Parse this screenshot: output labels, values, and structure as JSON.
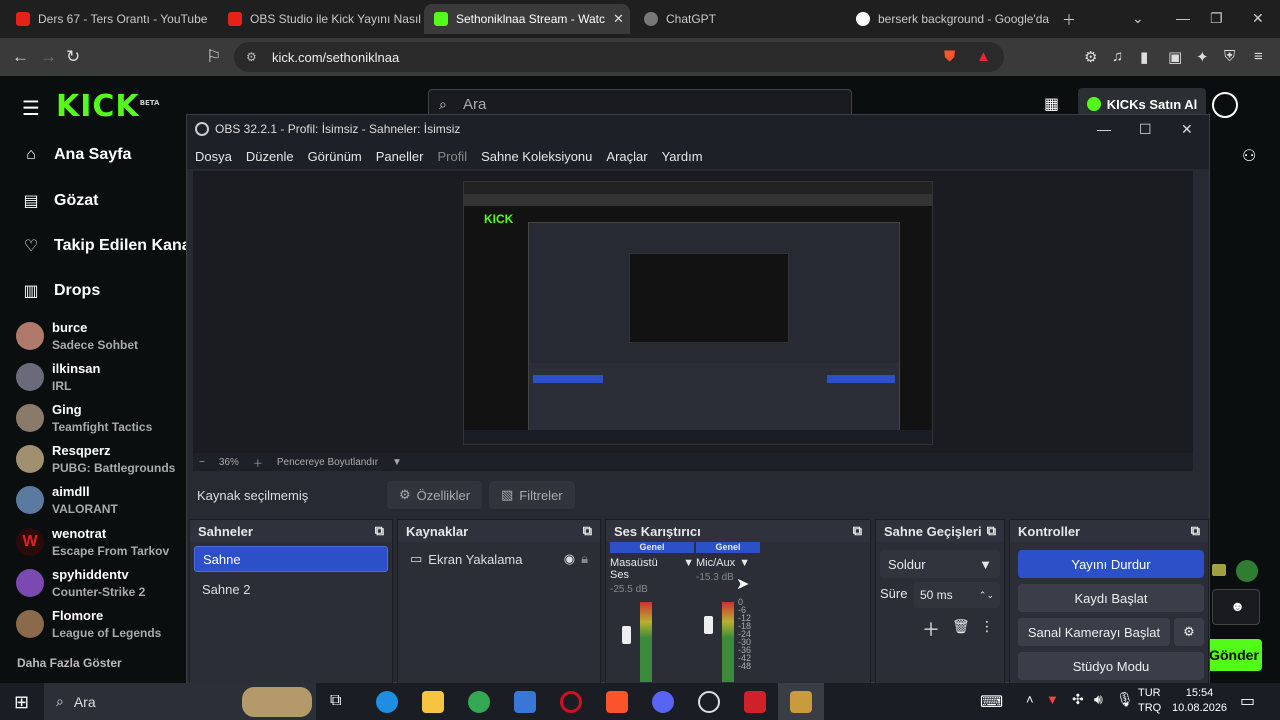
{
  "browser": {
    "tabs": [
      {
        "title": "Ders 67 - Ters Orantı - YouTube",
        "active": false
      },
      {
        "title": "OBS Studio ile Kick Yayını Nasıl A",
        "active": false
      },
      {
        "title": "Sethoniklnaa Stream - Watc",
        "active": true
      },
      {
        "title": "ChatGPT",
        "active": false
      },
      {
        "title": "berserk background - Google'da",
        "active": false
      }
    ],
    "url": "kick.com/sethoniklnaa"
  },
  "kick": {
    "logo": "KICK",
    "logo_badge": "BETA",
    "search_placeholder": "Ara",
    "kicks_button": "KICKs Satın Al",
    "nav": [
      {
        "label": "Ana Sayfa",
        "icon": "home-icon"
      },
      {
        "label": "Gözat",
        "icon": "browse-icon"
      },
      {
        "label": "Takip Edilen Kanal",
        "icon": "heart-icon"
      },
      {
        "label": "Drops",
        "icon": "drops-icon"
      }
    ],
    "channels": [
      {
        "name": "burce",
        "game": "Sadece Sohbet",
        "color": "#b07a6a"
      },
      {
        "name": "ilkinsan",
        "game": "IRL",
        "color": "#6a6a7a"
      },
      {
        "name": "Ging",
        "game": "Teamfight Tactics",
        "color": "#8a7a6a"
      },
      {
        "name": "Resqperz",
        "game": "PUBG: Battlegrounds",
        "color": "#a09070"
      },
      {
        "name": "aimdll",
        "game": "VALORANT",
        "color": "#5a7aa0"
      },
      {
        "name": "wenotrat",
        "game": "Escape From Tarkov",
        "color": "#c02020"
      },
      {
        "name": "spyhiddentv",
        "game": "Counter-Strike 2",
        "color": "#7a4ab0"
      },
      {
        "name": "Flomore",
        "game": "League of Legends",
        "color": "#8a6a4a"
      }
    ],
    "show_more": "Daha Fazla Göster",
    "send_button": "Gönder"
  },
  "obs": {
    "title": "OBS 32.2.1 - Profil: İsimsiz - Sahneler: İsimsiz",
    "menu": [
      "Dosya",
      "Düzenle",
      "Görünüm",
      "Paneller",
      "Profil",
      "Sahne Koleksiyonu",
      "Araçlar",
      "Yardım"
    ],
    "zoom": "36%",
    "fit": "Pencereye Boyutlandır",
    "no_source": "Kaynak seçilmemiş",
    "properties": "Özellikler",
    "filters": "Filtreler",
    "scenes_title": "Sahneler",
    "scenes": [
      "Sahne",
      "Sahne 2"
    ],
    "sources_title": "Kaynaklar",
    "sources": [
      "Ekran Yakalama"
    ],
    "mixer_title": "Ses Karıştırıcı",
    "mixer": [
      {
        "tag": "Genel",
        "name": "Masaüstü Ses",
        "db": "-25.5 dB"
      },
      {
        "tag": "Genel",
        "name": "Mic/Aux",
        "db": "-15.3 dB"
      }
    ],
    "meter_ticks": [
      "0",
      "-6",
      "-12",
      "-18",
      "-24",
      "-30",
      "-36",
      "-42",
      "-48"
    ],
    "transitions_title": "Sahne Geçişleri",
    "transition": "Soldur",
    "duration_label": "Süre",
    "duration_value": "50 ms",
    "controls_title": "Kontroller",
    "controls": [
      "Yayını Durdur",
      "Kaydı Başlat",
      "Sanal Kamerayı Başlat",
      "Stüdyo Modu"
    ]
  },
  "taskbar": {
    "search": "Ara",
    "lang_top": "TUR",
    "lang_bottom": "TRQ",
    "time": "15:54",
    "date": "10.08.2026"
  }
}
